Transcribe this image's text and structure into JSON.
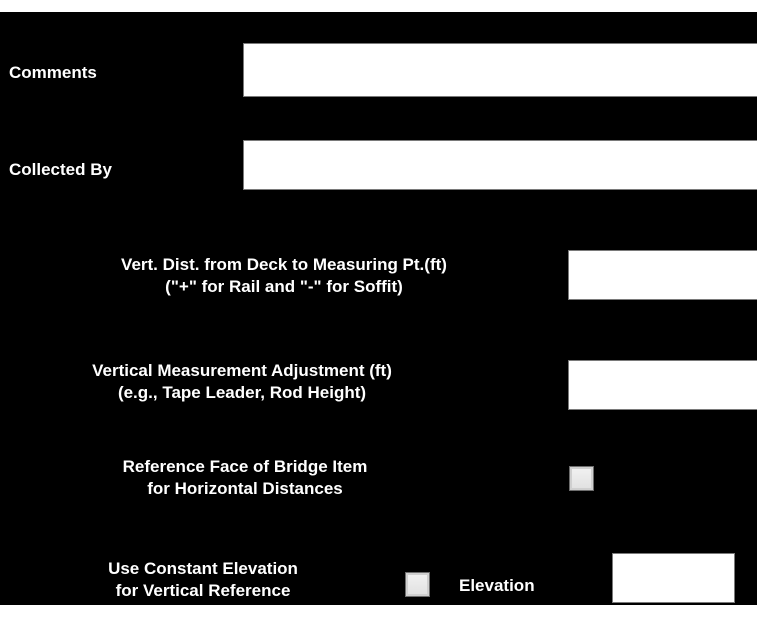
{
  "form": {
    "comments": {
      "label": "Comments",
      "value": ""
    },
    "collected_by": {
      "label": "Collected By",
      "value": ""
    },
    "vert_dist": {
      "label_line1": "Vert. Dist. from Deck to Measuring Pt.(ft)",
      "label_line2": "(\"+\" for Rail and \"-\" for Soffit)",
      "value": ""
    },
    "vert_adjust": {
      "label_line1": "Vertical Measurement Adjustment (ft)",
      "label_line2": "(e.g., Tape Leader, Rod Height)",
      "value": ""
    },
    "reference_face": {
      "label_line1": "Reference Face of Bridge Item",
      "label_line2": "for Horizontal Distances",
      "checked": false
    },
    "constant_elevation": {
      "label_line1": "Use Constant Elevation",
      "label_line2": "for Vertical Reference",
      "checked": false
    },
    "elevation": {
      "label": "Elevation",
      "value": ""
    }
  },
  "colors": {
    "background": "#000000",
    "label_text": "#ffffff",
    "field_background": "#ffffff"
  }
}
